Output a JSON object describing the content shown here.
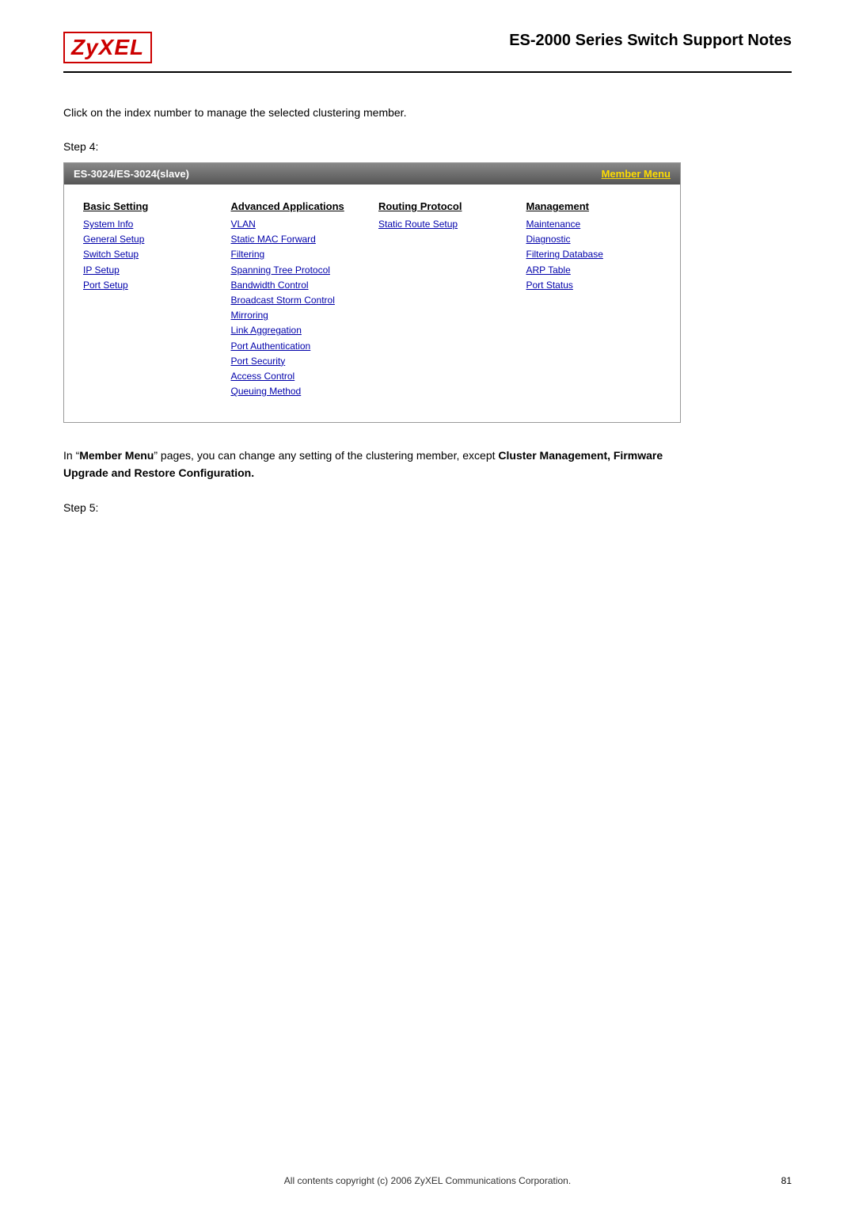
{
  "header": {
    "logo": "ZyXEL",
    "title": "ES-2000 Series Switch Support Notes"
  },
  "intro": {
    "text": "Click on the index number to manage the selected clustering member."
  },
  "step4": {
    "label": "Step 4:",
    "menu_box": {
      "title": "ES-3024/ES-3024(slave)",
      "member_menu_label": "Member Menu",
      "columns": [
        {
          "header": "Basic Setting",
          "links": [
            "System Info",
            "General Setup",
            "Switch Setup",
            "IP Setup",
            "Port Setup"
          ]
        },
        {
          "header": "Advanced Applications",
          "links": [
            "VLAN",
            "Static MAC Forward",
            "Filtering",
            "Spanning Tree Protocol",
            "Bandwidth Control",
            "Broadcast Storm Control",
            "Mirroring",
            "Link Aggregation",
            "Port Authentication",
            "Port Security",
            "Access Control",
            "Queuing Method"
          ]
        },
        {
          "header": "Routing Protocol",
          "links": [
            "Static Route Setup"
          ]
        },
        {
          "header": "Management",
          "links": [
            "Maintenance",
            "Diagnostic",
            "Filtering Database",
            "ARP Table",
            "Port Status"
          ]
        }
      ]
    }
  },
  "member_menu_paragraph": {
    "text_before_bold": "In “",
    "bold1": "Member Menu",
    "text_middle": "” pages, you can change any setting of the clustering member, except ",
    "bold2": "Cluster Management, Firmware Upgrade and Restore Configuration.",
    "text_after": ""
  },
  "step5": {
    "label": "Step 5:"
  },
  "footer": {
    "copyright": "All contents copyright (c) 2006 ZyXEL Communications Corporation.",
    "page_number": "81"
  }
}
